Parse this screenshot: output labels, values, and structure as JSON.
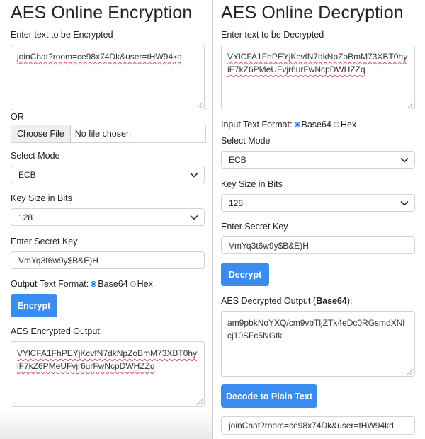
{
  "encryption": {
    "title": "AES Online Encryption",
    "input_label": "Enter text to be Encrypted",
    "input_value": "joinChat?room=ce98x74Dk&user=tHW94kd",
    "or_label": "OR",
    "file_button": "Choose File",
    "file_status": "No file chosen",
    "mode_label": "Select Mode",
    "mode_value": "ECB",
    "key_size_label": "Key Size in Bits",
    "key_size_value": "128",
    "secret_label": "Enter Secret Key",
    "secret_value": "VmYq3t6w9y$B&E)H",
    "format_label": "Output Text Format:",
    "format_option_base64": "Base64",
    "format_option_hex": "Hex",
    "format_selected": "Base64",
    "button": "Encrypt",
    "output_label": "AES Encrypted Output:",
    "output_value": "VYlCFA1FhPEYjKcvfN7dkNpZoBmM73XBT0hyiF7kZ6PMeUFvjr6urFwNcpDWHZZq"
  },
  "decryption": {
    "title": "AES Online Decryption",
    "input_label": "Enter text to be Decrypted",
    "input_value": "VYlCFA1FhPEYjKcvfN7dkNpZoBmM73XBT0hyiF7kZ6PMeUFvjr6urFwNcpDWHZZq",
    "format_label": "Input Text Format:",
    "format_option_base64": "Base64",
    "format_option_hex": "Hex",
    "format_selected": "Base64",
    "mode_label": "Select Mode",
    "mode_value": "ECB",
    "key_size_label": "Key Size in Bits",
    "key_size_value": "128",
    "secret_label": "Enter Secret Key",
    "secret_value": "VmYq3t6w9y$B&E)H",
    "button": "Decrypt",
    "output_label_prefix": "AES Decrypted Output (",
    "output_label_bold": "Base64",
    "output_label_suffix": "):",
    "output_value": "am9pbkNoYXQ/cm9vbTljZTk4eDc0RGsmdXNlcj10SFc5NGtk",
    "decode_button": "Decode to Plain Text",
    "plain_value": "joinChat?room=ce98x74Dk&user=tHW94kd"
  },
  "colors": {
    "accent": "#3b8cf0",
    "border": "#ced4da",
    "text": "#212529"
  },
  "icons": {
    "select_arrow": "chevron-down-icon",
    "resize": "resize-grip-icon"
  }
}
